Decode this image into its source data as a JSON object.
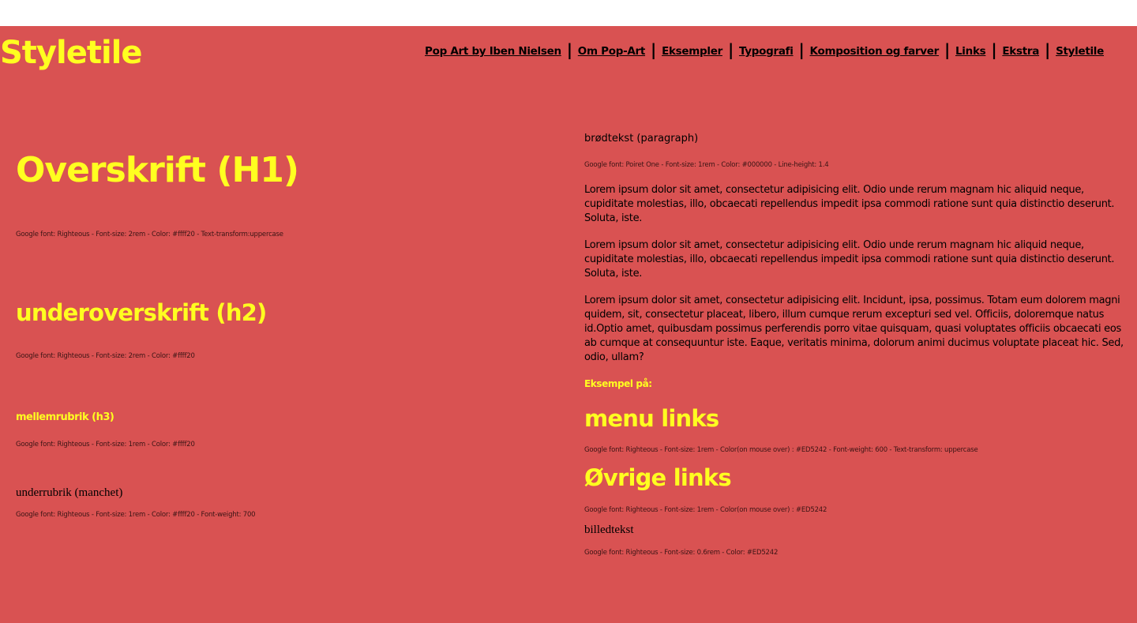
{
  "header": {
    "brand": "Styletile",
    "nav": [
      "Pop Art by Iben Nielsen",
      "Om Pop-Art",
      "Eksempler",
      "Typografi",
      "Komposition og farver",
      "Links",
      "Ekstra",
      "Styletile"
    ]
  },
  "left": {
    "h1": "Overskrift (H1)",
    "h1_meta": "Google font: Righteous - Font-size: 2rem - Color: #ffff20 - Text-transform:uppercase",
    "h2": "underoverskrift (h2)",
    "h2_meta": "Google font: Righteous - Font-size: 2rem - Color: #ffff20",
    "h3": "mellemrubrik (h3)",
    "h3_meta": "Google font: Righteous - Font-size: 1rem - Color: #ffff20",
    "manchet": "underrubrik (manchet)",
    "manchet_meta": "Google font: Righteous - Font-size: 1rem - Color: #ffff20 - Font-weight: 700"
  },
  "right": {
    "paragraph_label": "brødtekst (paragraph)",
    "paragraph_meta": "Google font: Poiret One - Font-size: 1rem - Color: #000000 - Line-height: 1.4",
    "lorem": [
      "Lorem ipsum dolor sit amet, consectetur adipisicing elit. Odio unde rerum magnam hic aliquid neque, cupiditate molestias, illo, obcaecati repellendus impedit ipsa commodi ratione sunt quia distinctio deserunt. Soluta, iste.",
      "Lorem ipsum dolor sit amet, consectetur adipisicing elit. Odio unde rerum magnam hic aliquid neque, cupiditate molestias, illo, obcaecati repellendus impedit ipsa commodi ratione sunt quia distinctio deserunt. Soluta, iste.",
      "Lorem ipsum dolor sit amet, consectetur adipisicing elit. Incidunt, ipsa, possimus. Totam eum dolorem magni quidem, sit, consectetur placeat, libero, illum cumque rerum excepturi sed vel. Officiis, doloremque natus id.Optio amet, quibusdam possimus perferendis porro vitae quisquam, quasi voluptates officiis obcaecati eos ab cumque at consequuntur iste. Eaque, veritatis minima, dolorum animi ducimus voluptate placeat hic. Sed, odio, ullam?"
    ],
    "example_label": "Eksempel på:",
    "menu_links": "menu links",
    "menu_links_meta": "Google font: Righteous - Font-size: 1rem - Color(on mouse over) : #ED5242 - Font-weight: 600 - Text-transform: uppercase",
    "other_links": "Øvrige links",
    "other_links_meta": "Google font: Righteous - Font-size: 1rem - Color(on mouse over) : #ED5242",
    "caption": "billedtekst",
    "caption_meta": "Google font: Righteous - Font-size: 0.6rem - Color: #ED5242"
  },
  "colors": {
    "background": "#d95252",
    "accent_yellow": "#ffff20",
    "text": "#000000",
    "hover": "#ED5242"
  }
}
